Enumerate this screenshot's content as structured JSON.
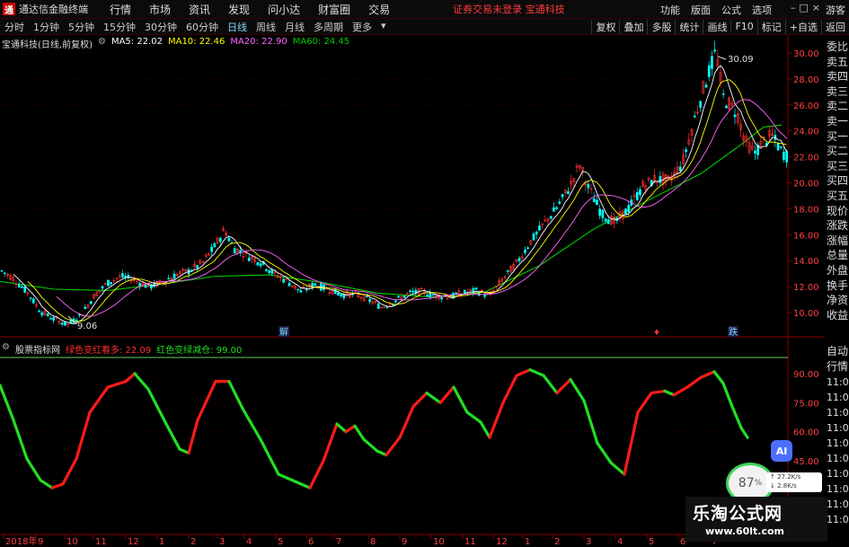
{
  "titlebar": {
    "app_title": "通达信金融终端",
    "menu": [
      "行情",
      "市场",
      "资讯",
      "发现",
      "问小达",
      "财富圈",
      "交易"
    ],
    "notice": "证券交易未登录  宝通科技",
    "right_menu": [
      "功能",
      "版面",
      "公式",
      "选项"
    ],
    "window_controls": [
      "–",
      "□",
      "×"
    ],
    "guest": "游客"
  },
  "toolbar": {
    "periods": [
      "分时",
      "1分钟",
      "5分钟",
      "15分钟",
      "30分钟",
      "60分钟",
      "日线",
      "周线",
      "月线",
      "多周期",
      "更多"
    ],
    "active_period": "日线",
    "right_tools": [
      "复权",
      "叠加",
      "多股",
      "统计",
      "画线",
      "F10",
      "标记",
      "+自选",
      "返回"
    ]
  },
  "main_legend": {
    "stock": "宝通科技(日线,前复权)",
    "ma5": "MA5: 22.02",
    "ma10": "MA10: 22.46",
    "ma20": "MA20: 22.90",
    "ma60": "MA60: 24.45"
  },
  "indicator_legend": {
    "name": "股票指标网",
    "green": "绿色变红看多: 22.09",
    "red": "红色变绿减仓: 99.00"
  },
  "colors": {
    "up": "#ff3030",
    "down": "#00ffff",
    "ma5": "#ffffff",
    "ma10": "#ffff00",
    "ma20": "#ff66ff",
    "ma60": "#00cc00",
    "ind_red": "#ff1a1a",
    "ind_green": "#22dd22",
    "grid": "#5a0000"
  },
  "price_axis": [
    "30.00",
    "28.00",
    "26.00",
    "24.00",
    "22.00",
    "20.00",
    "18.00",
    "16.00",
    "14.00",
    "12.00",
    "10.00"
  ],
  "indicator_axis": [
    "90.00",
    "75.00",
    "60.00",
    "45.00"
  ],
  "annotations": {
    "high": "30.09",
    "low": "9.06",
    "mark1": "解",
    "mark2": "跌",
    "mark3": "♦"
  },
  "time_axis": [
    "2018年",
    "9",
    "10",
    "11",
    "12",
    "1",
    "2",
    "3",
    "4",
    "5",
    "6",
    "7",
    "8",
    "9",
    "10",
    "11",
    "12",
    "1",
    "2",
    "3",
    "4",
    "5",
    "6",
    "7"
  ],
  "right_sidebar": [
    "委比",
    "卖五",
    "卖四",
    "卖三",
    "卖二",
    "卖一",
    "买一",
    "买二",
    "买三",
    "买四",
    "买五",
    "现价",
    "涨跌",
    "涨幅",
    "总量",
    "外盘",
    "换手",
    "净资",
    "收益"
  ],
  "right_sidebar2": [
    "自动",
    "行情",
    "11:01",
    "11:01",
    "11:01",
    "11:02",
    "11:02",
    "11:02",
    "11:02",
    "11:02",
    "11:02",
    "11:03"
  ],
  "watermark": {
    "title": "乐淘公式网",
    "url": "www.60lt.com"
  },
  "overlay": {
    "ai": "AI",
    "net_pct": "87",
    "net_speed": "27.2K/s",
    "net_speed2": "2.8K/s"
  },
  "chart_data": {
    "type": "line",
    "title": "宝通科技(日线,前复权)",
    "ylim": [
      9,
      31
    ],
    "price_path": [
      [
        0,
        13.3
      ],
      [
        15,
        12.6
      ],
      [
        30,
        11.6
      ],
      [
        45,
        10.1
      ],
      [
        60,
        9.5
      ],
      [
        75,
        9.06
      ],
      [
        90,
        9.8
      ],
      [
        105,
        11.3
      ],
      [
        120,
        12.3
      ],
      [
        135,
        12.8
      ],
      [
        150,
        12.5
      ],
      [
        165,
        12.0
      ],
      [
        180,
        12.3
      ],
      [
        195,
        12.9
      ],
      [
        210,
        13.2
      ],
      [
        225,
        13.8
      ],
      [
        240,
        15.2
      ],
      [
        250,
        16.4
      ],
      [
        260,
        15.0
      ],
      [
        275,
        14.4
      ],
      [
        290,
        13.9
      ],
      [
        305,
        13.0
      ],
      [
        320,
        12.4
      ],
      [
        335,
        11.6
      ],
      [
        350,
        12.2
      ],
      [
        365,
        11.8
      ],
      [
        380,
        11.4
      ],
      [
        395,
        11.4
      ],
      [
        410,
        11.0
      ],
      [
        425,
        10.4
      ],
      [
        440,
        10.9
      ],
      [
        455,
        11.5
      ],
      [
        470,
        11.6
      ],
      [
        485,
        11.3
      ],
      [
        500,
        11.2
      ],
      [
        515,
        11.5
      ],
      [
        530,
        11.7
      ],
      [
        545,
        11.3
      ],
      [
        560,
        12.6
      ],
      [
        575,
        13.8
      ],
      [
        590,
        15.4
      ],
      [
        605,
        16.8
      ],
      [
        620,
        18.1
      ],
      [
        635,
        19.8
      ],
      [
        645,
        21.4
      ],
      [
        655,
        19.6
      ],
      [
        670,
        17.6
      ],
      [
        685,
        16.9
      ],
      [
        700,
        18.1
      ],
      [
        715,
        19.7
      ],
      [
        730,
        20.3
      ],
      [
        745,
        20.1
      ],
      [
        760,
        21.6
      ],
      [
        775,
        25.4
      ],
      [
        790,
        28.8
      ],
      [
        797,
        30.09
      ],
      [
        805,
        26.6
      ],
      [
        820,
        25.4
      ],
      [
        830,
        23.1
      ],
      [
        840,
        22.3
      ],
      [
        850,
        23.2
      ],
      [
        860,
        23.6
      ],
      [
        870,
        22.4
      ],
      [
        878,
        22.0
      ]
    ],
    "ma60_path": [
      [
        0,
        12.4
      ],
      [
        60,
        11.8
      ],
      [
        120,
        11.7
      ],
      [
        180,
        12.2
      ],
      [
        240,
        12.8
      ],
      [
        300,
        12.9
      ],
      [
        360,
        12.3
      ],
      [
        420,
        11.5
      ],
      [
        480,
        11.2
      ],
      [
        540,
        11.6
      ],
      [
        600,
        13.6
      ],
      [
        660,
        16.4
      ],
      [
        720,
        18.6
      ],
      [
        780,
        20.7
      ],
      [
        820,
        22.7
      ],
      [
        850,
        24.3
      ],
      [
        870,
        24.45
      ]
    ],
    "indicator_path": [
      [
        0,
        84
      ],
      [
        15,
        66
      ],
      [
        30,
        46
      ],
      [
        45,
        35
      ],
      [
        58,
        31
      ],
      [
        70,
        33
      ],
      [
        85,
        46
      ],
      [
        100,
        70
      ],
      [
        120,
        83
      ],
      [
        140,
        86
      ],
      [
        150,
        90
      ],
      [
        165,
        82
      ],
      [
        185,
        64
      ],
      [
        200,
        51
      ],
      [
        210,
        49
      ],
      [
        220,
        66
      ],
      [
        240,
        86
      ],
      [
        255,
        86
      ],
      [
        270,
        72
      ],
      [
        290,
        56
      ],
      [
        310,
        38
      ],
      [
        320,
        36
      ],
      [
        335,
        33
      ],
      [
        345,
        31
      ],
      [
        360,
        45
      ],
      [
        375,
        64
      ],
      [
        385,
        60
      ],
      [
        395,
        63
      ],
      [
        405,
        56
      ],
      [
        420,
        50
      ],
      [
        430,
        48
      ],
      [
        445,
        57
      ],
      [
        460,
        73
      ],
      [
        475,
        80
      ],
      [
        490,
        75
      ],
      [
        505,
        83
      ],
      [
        520,
        70
      ],
      [
        535,
        65
      ],
      [
        545,
        57
      ],
      [
        560,
        75
      ],
      [
        575,
        89
      ],
      [
        590,
        92
      ],
      [
        605,
        89
      ],
      [
        620,
        80
      ],
      [
        635,
        87
      ],
      [
        650,
        76
      ],
      [
        665,
        54
      ],
      [
        680,
        44
      ],
      [
        695,
        38
      ],
      [
        710,
        70
      ],
      [
        725,
        80
      ],
      [
        740,
        81
      ],
      [
        750,
        79
      ],
      [
        765,
        83
      ],
      [
        780,
        88
      ],
      [
        795,
        91
      ],
      [
        805,
        85
      ],
      [
        815,
        73
      ],
      [
        825,
        62
      ],
      [
        832,
        57
      ]
    ],
    "indicator_ylim": [
      30,
      100
    ]
  }
}
